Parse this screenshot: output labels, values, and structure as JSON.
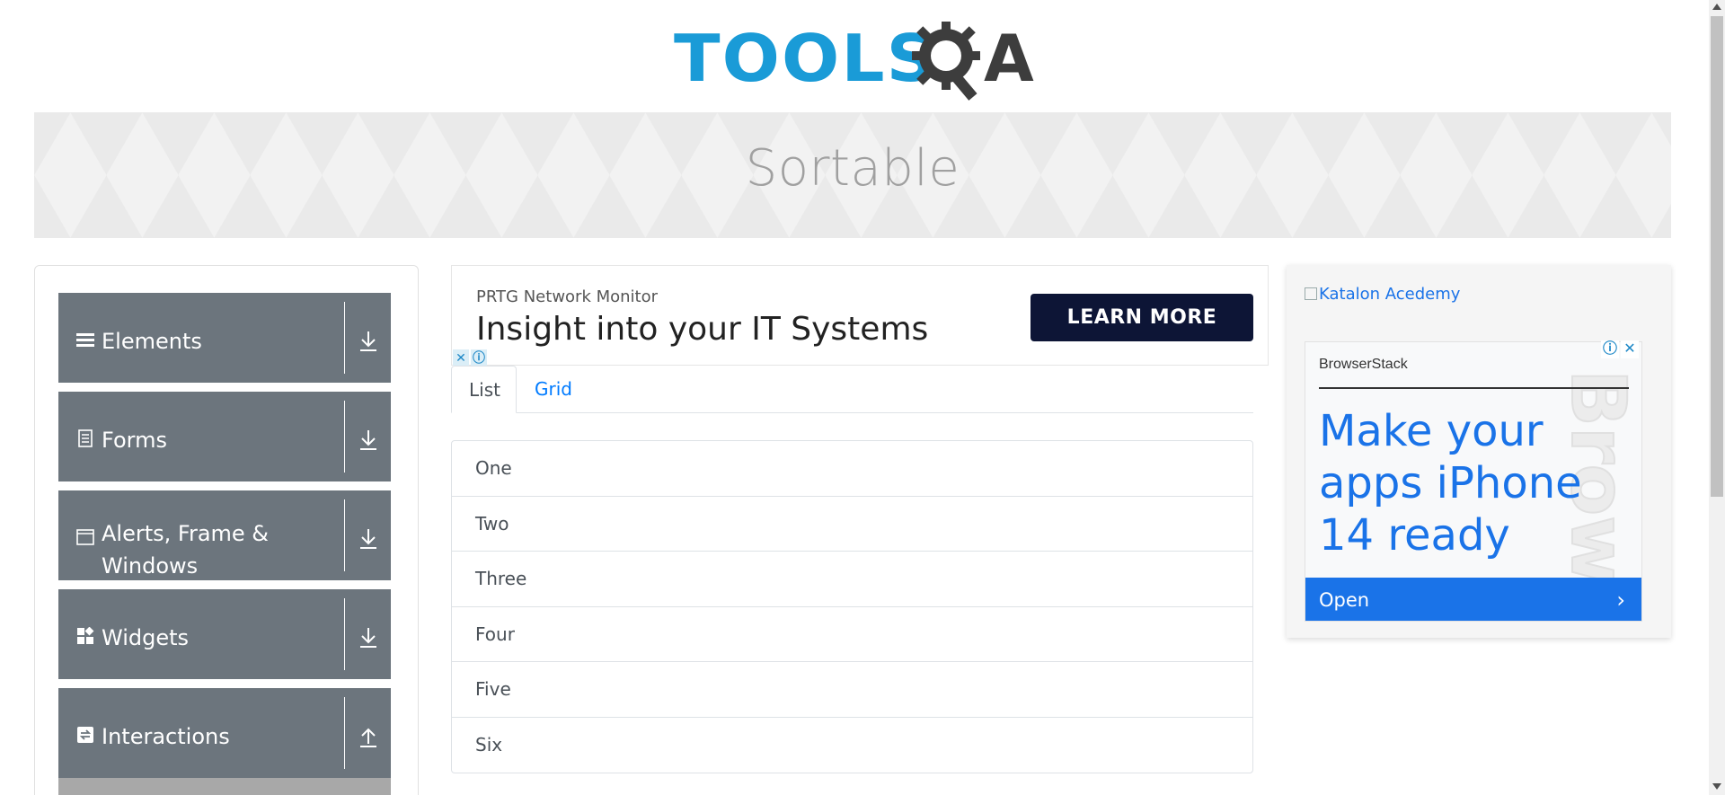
{
  "logo": {
    "text_primary": "TOOLS",
    "text_secondary": "A"
  },
  "banner": {
    "title": "Sortable"
  },
  "sidebar": {
    "items": [
      {
        "label": "Elements",
        "icon": "hamburger-icon",
        "arrow": "download-icon"
      },
      {
        "label": "Forms",
        "icon": "document-icon",
        "arrow": "download-icon"
      },
      {
        "label": "Alerts, Frame & Windows",
        "icon": "window-icon",
        "arrow": "download-icon"
      },
      {
        "label": "Widgets",
        "icon": "widgets-icon",
        "arrow": "download-icon"
      },
      {
        "label": "Interactions",
        "icon": "refresh-icon",
        "arrow": "upload-icon"
      }
    ]
  },
  "ad_top": {
    "brand": "PRTG Network Monitor",
    "headline": "Insight into your IT Systems",
    "cta": "LEARN MORE",
    "close_mark": "✕",
    "info_mark": "ⓘ"
  },
  "tabs": [
    {
      "label": "List",
      "active": true
    },
    {
      "label": "Grid",
      "active": false
    }
  ],
  "list": {
    "items": [
      "One",
      "Two",
      "Three",
      "Four",
      "Five",
      "Six"
    ]
  },
  "ad_right": {
    "image_alt": "Katalon Acedemy",
    "card": {
      "brand": "BrowserStack",
      "headline": "Make your apps iPhone 14 ready",
      "watermark": "Browse",
      "open_label": "Open",
      "open_chevron": "›",
      "info_mark": "ⓘ",
      "close_mark": "✕"
    }
  },
  "colors": {
    "logo_blue": "#1a9bd7",
    "logo_dark": "#3d3d3d",
    "sidebar_bg": "#6c757d",
    "cta_bg": "#0d1536",
    "link_blue": "#007bff",
    "bs_blue": "#1a73e8"
  }
}
